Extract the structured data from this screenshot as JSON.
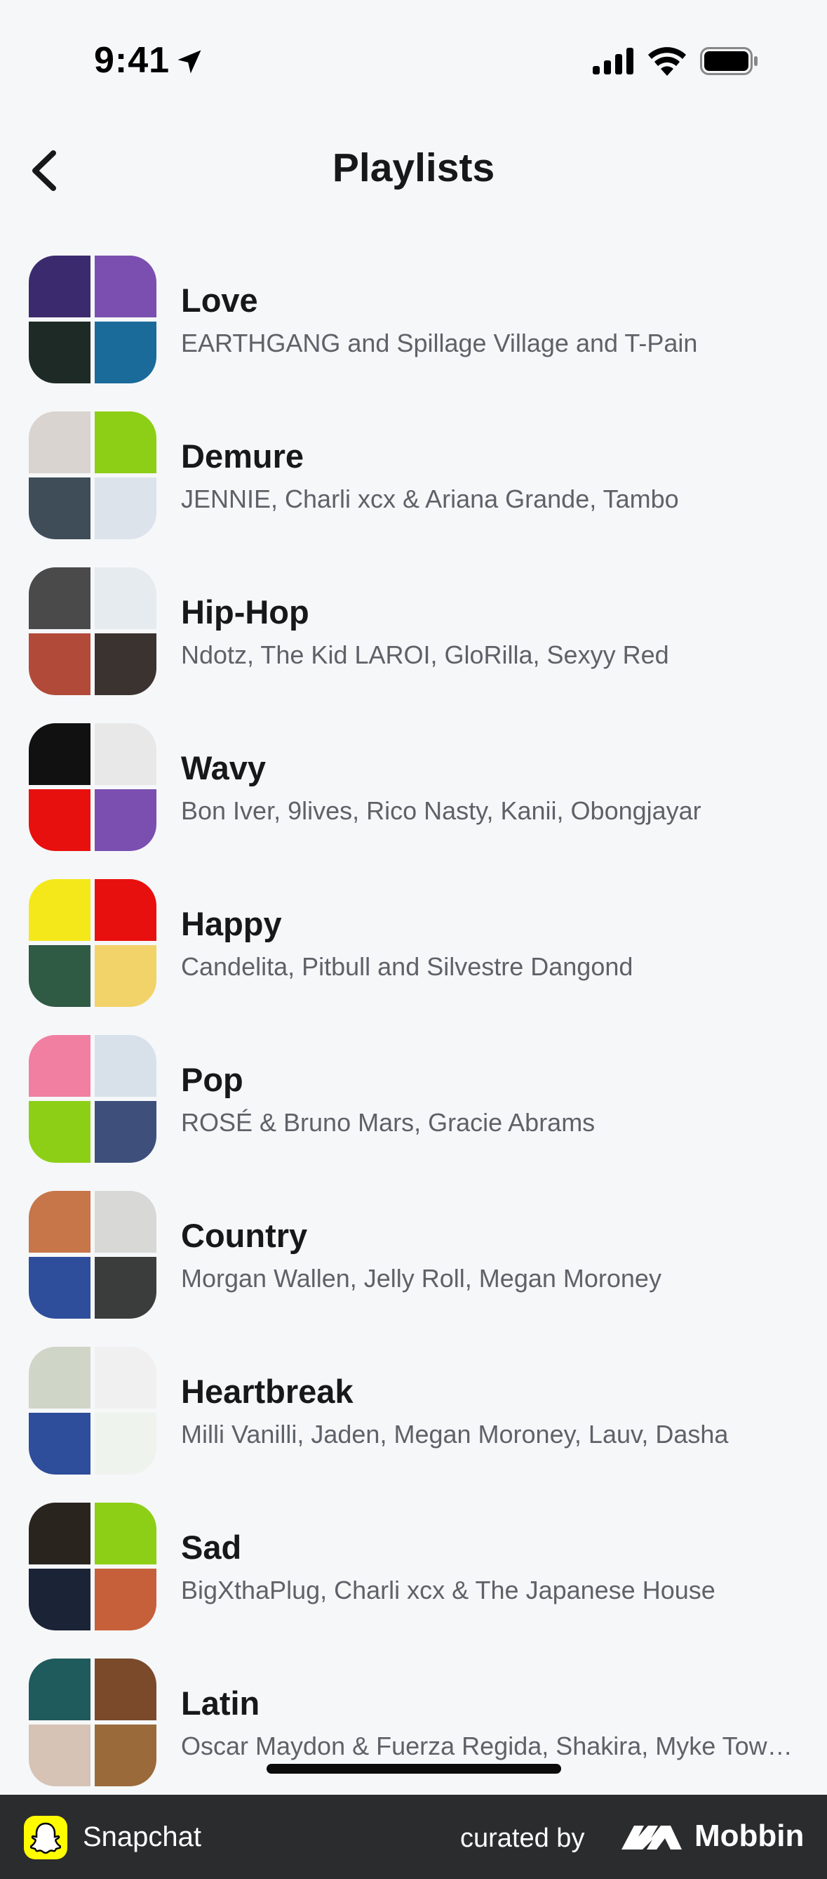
{
  "status_bar": {
    "time": "9:41"
  },
  "header": {
    "title": "Playlists"
  },
  "playlists": [
    {
      "title": "Love",
      "artists": "EARTHGANG and Spillage Village and T-Pain",
      "art_colors": [
        "#3b2b6e",
        "#7a4fb0",
        "#1d2a25",
        "#1a6a9a"
      ]
    },
    {
      "title": "Demure",
      "artists": "JENNIE, Charli xcx & Ariana Grande, Tambo",
      "art_colors": [
        "#d9d4cf",
        "#8ccf16",
        "#3e4d58",
        "#dde3ea"
      ]
    },
    {
      "title": "Hip-Hop",
      "artists": "Ndotz, The Kid LAROI, GloRilla, Sexyy Red",
      "art_colors": [
        "#4a4a4a",
        "#e6ebf0",
        "#b24a3a",
        "#3a3330"
      ]
    },
    {
      "title": "Wavy",
      "artists": "Bon Iver, 9lives, Rico Nasty, Kanii, Obongjayar",
      "art_colors": [
        "#111111",
        "#e8e8e8",
        "#e8100e",
        "#7a4fb0"
      ]
    },
    {
      "title": "Happy",
      "artists": "Candelita, Pitbull and Silvestre Dangond",
      "art_colors": [
        "#f4e81b",
        "#e8100e",
        "#2f5a44",
        "#f2d36a"
      ]
    },
    {
      "title": "Pop",
      "artists": "ROSÉ & Bruno Mars, Gracie Abrams",
      "art_colors": [
        "#f07fa2",
        "#d8e1ea",
        "#8ccf16",
        "#3d4f7a"
      ]
    },
    {
      "title": "Country",
      "artists": "Morgan Wallen, Jelly Roll, Megan Moroney",
      "art_colors": [
        "#c7764a",
        "#d8d8d6",
        "#2e4d9b",
        "#3b3d3d"
      ]
    },
    {
      "title": "Heartbreak",
      "artists": "Milli Vanilli, Jaden, Megan Moroney, Lauv, Dasha",
      "art_colors": [
        "#cfd6c8",
        "#f0f0f0",
        "#2e4d9b",
        "#eef3ee"
      ]
    },
    {
      "title": "Sad",
      "artists": "BigXthaPlug, Charli xcx & The Japanese House",
      "art_colors": [
        "#2a241f",
        "#8ccf16",
        "#1b2336",
        "#c6603a"
      ]
    },
    {
      "title": "Latin",
      "artists": "Oscar Maydon & Fuerza Regida, Shakira, Myke Towers",
      "art_colors": [
        "#1f5a5c",
        "#7a4a2a",
        "#d6c3b5",
        "#9b6a3a"
      ]
    }
  ],
  "footer": {
    "app_name": "Snapchat",
    "curated_by": "curated by",
    "brand": "Mobbin"
  },
  "icons": {
    "back": "chevron-left-icon",
    "location": "location-arrow-icon",
    "signal": "signal-icon",
    "wifi": "wifi-icon",
    "battery": "battery-icon"
  },
  "colors": {
    "background": "#f6f7f9",
    "title": "#17181a",
    "subtitle": "#5e6268",
    "footer": "#2b2c2e",
    "snap_yellow": "#fffc00"
  }
}
